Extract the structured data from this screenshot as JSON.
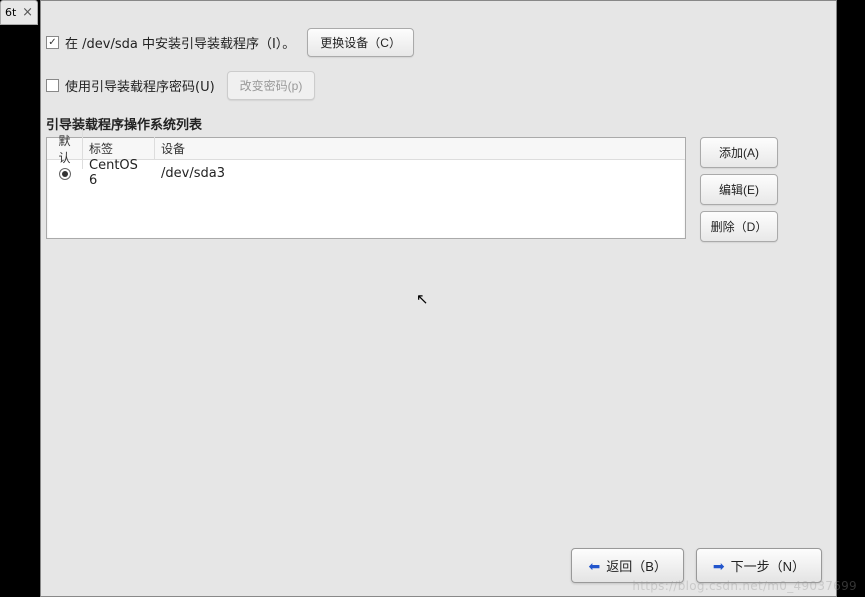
{
  "window": {
    "tab_fragment": "6t"
  },
  "bootloader": {
    "install_label": "在 /dev/sda 中安装引导装载程序（I）。",
    "change_device_button": "更换设备（C）",
    "use_password_label": "使用引导装载程序密码(U)",
    "change_password_button": "改变密码(p)"
  },
  "os_list": {
    "title": "引导装载程序操作系统列表",
    "columns": {
      "default": "默认",
      "label": "标签",
      "device": "设备"
    },
    "rows": [
      {
        "selected": true,
        "label": "CentOS 6",
        "device": "/dev/sda3"
      }
    ],
    "side_buttons": {
      "add": "添加(A)",
      "edit": "编辑(E)",
      "delete": "删除（D）"
    }
  },
  "footer": {
    "back": "返回（B）",
    "next": "下一步（N）"
  },
  "watermark": "https://blog.csdn.net/m0_49037699"
}
